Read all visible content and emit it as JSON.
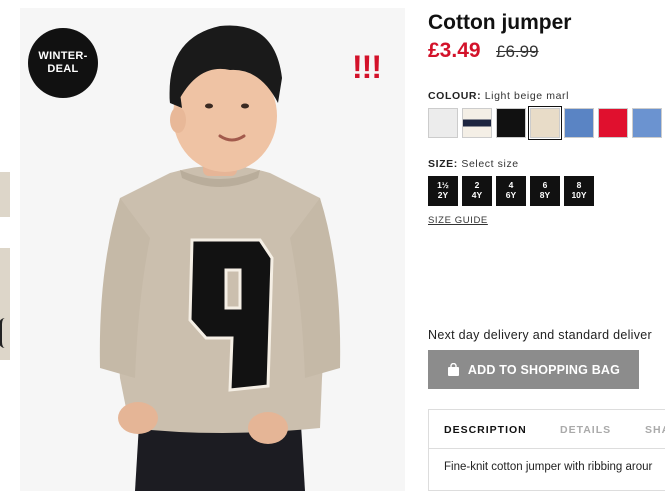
{
  "product": {
    "badge": "WINTER-\nDEAL",
    "alert": "!!!",
    "title": "Cotton jumper",
    "price_now": "£3.49",
    "price_old": "£6.99"
  },
  "colour": {
    "label": "COLOUR:",
    "value": "Light beige marl",
    "swatches": [
      {
        "color": "#ececec"
      },
      {
        "color": "stripe"
      },
      {
        "color": "#111111"
      },
      {
        "color": "#e8dcc8",
        "selected": true
      },
      {
        "color": "#5a84c4"
      },
      {
        "color": "#e0102e"
      },
      {
        "color": "#6b93d0"
      }
    ]
  },
  "size": {
    "label": "SIZE:",
    "value": "Select size",
    "options": [
      "1½\n2Y",
      "2\n4Y",
      "4\n6Y",
      "6\n8Y",
      "8\n10Y"
    ],
    "guide": "SIZE GUIDE"
  },
  "delivery": "Next day delivery and standard deliver",
  "add_button": "ADD TO SHOPPING BAG",
  "tabs": [
    "DESCRIPTION",
    "DETAILS",
    "SHA"
  ],
  "description": "Fine-knit cotton jumper with ribbing arour",
  "colors": {
    "sale_red": "#d3122a",
    "button_grey": "#8c8c8c"
  }
}
